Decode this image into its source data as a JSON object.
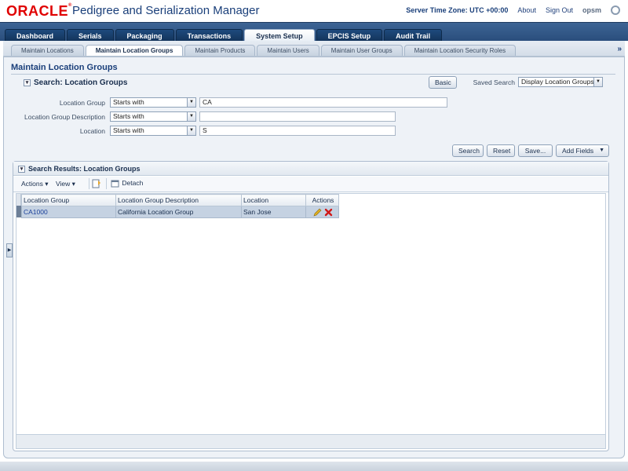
{
  "header": {
    "brand": "ORACLE",
    "app_title": "Pedigree and Serialization Manager",
    "server_time": "Server Time Zone: UTC +00:00",
    "about": "About",
    "sign_out": "Sign Out",
    "user": "opsm"
  },
  "main_tabs": [
    "Dashboard",
    "Serials",
    "Packaging",
    "Transactions",
    "System Setup",
    "EPCIS Setup",
    "Audit Trail"
  ],
  "active_main_tab": "System Setup",
  "sub_tabs": [
    "Maintain Locations",
    "Maintain Location Groups",
    "Maintain Products",
    "Maintain Users",
    "Maintain User Groups",
    "Maintain Location Security Roles"
  ],
  "active_sub_tab": "Maintain Location Groups",
  "page_title": "Maintain Location Groups",
  "search": {
    "title": "Search: Location Groups",
    "basic_button": "Basic",
    "saved_search_label": "Saved Search",
    "saved_search_value": "Display Location Groups",
    "fields": [
      {
        "label": "Location Group",
        "operator": "Starts with",
        "value": "CA"
      },
      {
        "label": "Location Group Description",
        "operator": "Starts with",
        "value": ""
      },
      {
        "label": "Location",
        "operator": "Starts with",
        "value": "S"
      }
    ],
    "buttons": {
      "search": "Search",
      "reset": "Reset",
      "save": "Save...",
      "add_fields": "Add Fields"
    }
  },
  "results": {
    "title": "Search Results: Location Groups",
    "toolbar": {
      "actions": "Actions",
      "view": "View",
      "detach": "Detach"
    },
    "columns": [
      "Location Group",
      "Location Group Description",
      "Location",
      "Actions"
    ],
    "rows": [
      {
        "location_group": "CA1000",
        "description": "California Location Group",
        "location": "San Jose"
      }
    ]
  },
  "colors": {
    "brand_red": "#e00000",
    "nav_blue": "#2a4e7c",
    "title_blue": "#1a3f7a"
  }
}
